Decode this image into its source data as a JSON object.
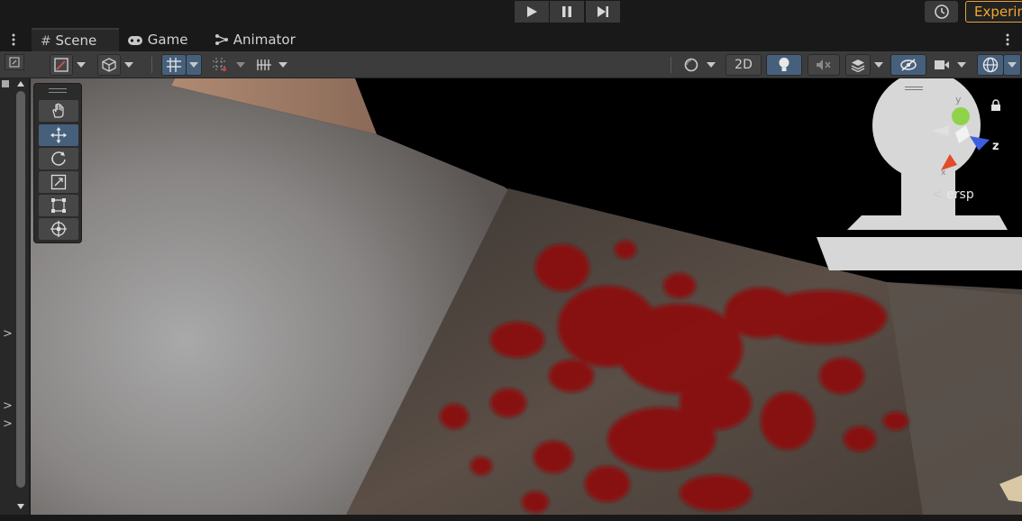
{
  "playbar": {
    "play_icon": "play-icon",
    "pause_icon": "pause-icon",
    "step_icon": "step-icon",
    "history_icon": "history-icon",
    "experimental_label": "Experim"
  },
  "tabs": [
    {
      "label": "Scene",
      "icon": "grid-icon",
      "active": true
    },
    {
      "label": "Game",
      "icon": "gamepad-icon",
      "active": false
    },
    {
      "label": "Animator",
      "icon": "animator-icon",
      "active": false
    }
  ],
  "toolbar": {
    "mode_2d_label": "2D"
  },
  "gizmo": {
    "axis_y": "y",
    "axis_z": "z",
    "axis_x": "x",
    "projection_label": "ersp"
  },
  "tool_palette": [
    "hand",
    "move",
    "rotate",
    "scale",
    "rect",
    "transform"
  ],
  "colors": {
    "accent_orange": "#f0a830",
    "selected_blue": "#46607c",
    "blood_red": "#8c0a0a"
  }
}
